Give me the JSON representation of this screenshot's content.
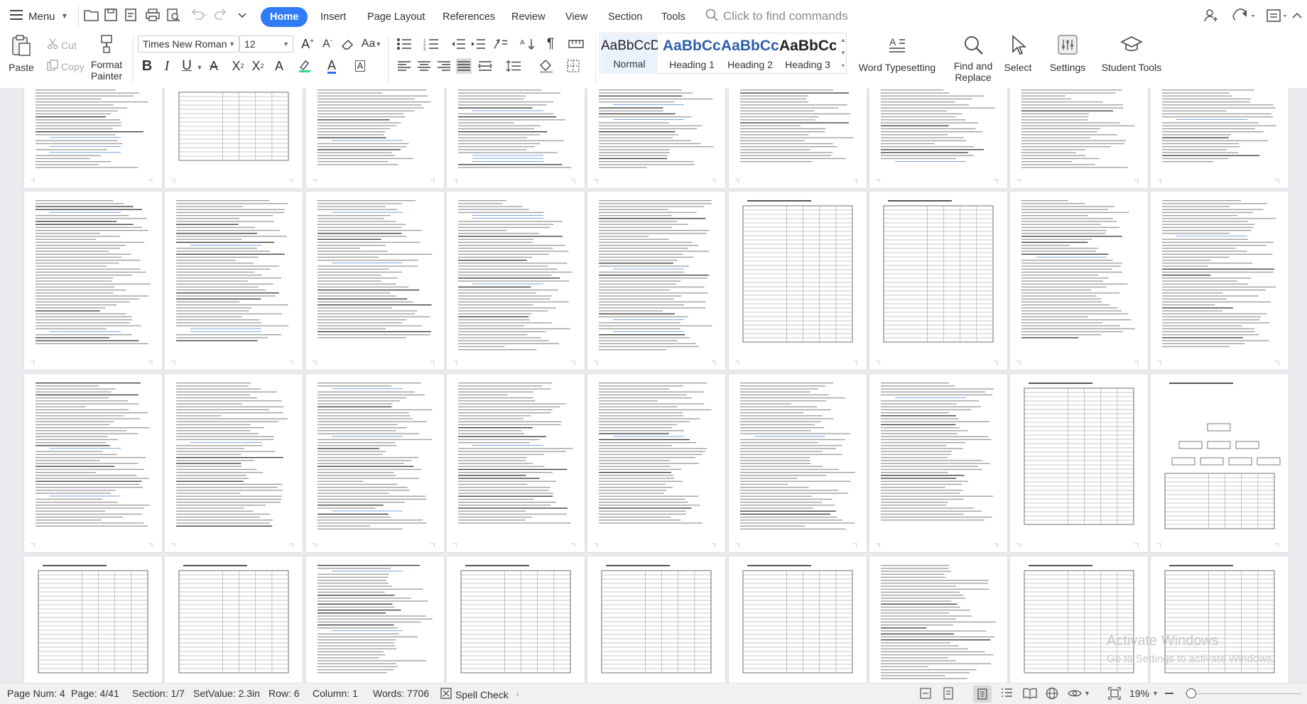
{
  "menu_label": "Menu",
  "tabs": [
    {
      "label": "Home",
      "active": true
    },
    {
      "label": "Insert"
    },
    {
      "label": "Page Layout"
    },
    {
      "label": "References"
    },
    {
      "label": "Review"
    },
    {
      "label": "View"
    },
    {
      "label": "Section"
    },
    {
      "label": "Tools"
    }
  ],
  "search_placeholder": "Click to find commands",
  "ribbon": {
    "paste": "Paste",
    "cut": "Cut",
    "copy": "Copy",
    "format_painter": "Format Painter",
    "font_name": "Times New Roman",
    "font_size": "12",
    "styles": [
      {
        "sample": "AaBbCcDd",
        "name": "Normal",
        "heading": false
      },
      {
        "sample": "AaBbCc",
        "name": "Heading 1",
        "heading": true
      },
      {
        "sample": "AaBbCc",
        "name": "Heading 2",
        "heading": true
      },
      {
        "sample": "AaBbCcI",
        "name": "Heading 3",
        "heading": true
      }
    ],
    "word_typesetting": "Word Typesetting",
    "find_replace": "Find and Replace",
    "select": "Select",
    "settings": "Settings",
    "student_tools": "Student Tools"
  },
  "status": {
    "page_num": "Page Num: 4",
    "page": "Page: 4/41",
    "section": "Section: 1/7",
    "setvalue": "SetValue: 2.3in",
    "row": "Row: 6",
    "column": "Column: 1",
    "words": "Words: 7706",
    "spell_check": "Spell Check",
    "zoom": "19%"
  },
  "watermark": {
    "line1": "Activate Windows",
    "line2": "Go to Settings to activate Windows."
  },
  "colors": {
    "accent": "#2f7cf6",
    "heading": "#2e5fa8",
    "canvas": "#e9ebee"
  }
}
